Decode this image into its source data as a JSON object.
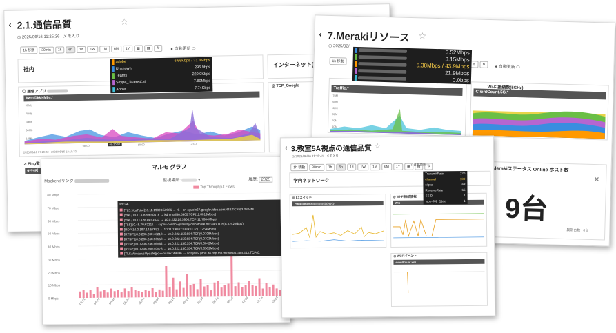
{
  "win1": {
    "title": "2.1.通信品質",
    "date": "2025/06/16 11:25:36",
    "fav": "メモ入り",
    "toolbar": [
      "1h 移動",
      "30min",
      "1h",
      "6h",
      "1d",
      "1W",
      "1M",
      "6M",
      "1Y"
    ],
    "auto": "自動更新",
    "section1": "社内",
    "section2": "インターネット(",
    "app_label": "通信アプリ",
    "tcp_label": "TCP_Google",
    "ping_label": "Ping監",
    "chart_header": "bwm@kkl4Mbs.*",
    "group_label": "group(",
    "time_label": "09:20:00",
    "x_ticks": [
      "08:00",
      "10:00",
      "12:00"
    ],
    "y_ticks": [
      "90Mb",
      "70Mb",
      "50Mb",
      "30Mb",
      "10Mb"
    ],
    "range": "2025/06/16 07:10:32 - 2025/06/16 13:10:32",
    "tooltip": [
      {
        "name": "adobe",
        "val": "6.66Kbps",
        "max": "31.8Mbps",
        "color": "#ff9900",
        "hl": true
      },
      {
        "name": "Unknown",
        "val": "295.9bps",
        "max": "",
        "color": "#3a8de0"
      },
      {
        "name": "Teams",
        "val": "229.9Kbps",
        "max": "",
        "color": "#6abf45"
      },
      {
        "name": "Skype_TeamsCall",
        "val": "7.80Mbps",
        "max": "",
        "color": "#b566d0"
      },
      {
        "name": "Apple",
        "val": "7.74Kbps",
        "max": "",
        "color": "#3fbfd8"
      }
    ]
  },
  "win2": {
    "title": "7.Merakiリソース",
    "date": "2025/02/",
    "toolbar": [
      "1h 移動"
    ],
    "auto": "自動更新",
    "traffic": "Traffic.*",
    "wifi": "Wi-Fi接続数(5GHz)",
    "client": "ClientCount.5G.*",
    "online_title": "Merakiステータス Online ホスト数",
    "big": "9台",
    "footer": "異常台数",
    "footer2": "0台",
    "tooltip": [
      {
        "val": "3.52Mbps",
        "max": "",
        "color": "#3a8de0"
      },
      {
        "val": "3.15Mbps",
        "max": "",
        "color": "#6abf45"
      },
      {
        "val": "5.38Mbps",
        "max": "43.9Mbps",
        "color": "#ff9900",
        "hl": true
      },
      {
        "val": "21.9Mbps",
        "max": "",
        "color": "#b566d0"
      },
      {
        "val": "0.0bps",
        "max": "",
        "color": "#3fbfd8"
      }
    ],
    "y_ticks": [
      "70M",
      "50M",
      "40M",
      "30M",
      "20M",
      "10M"
    ]
  },
  "win3": {
    "title": "3.教室5A視点の通信品質",
    "date": "2025/06/16 11:35:41",
    "fav": "メモ入り",
    "toolbar": [
      "1h 移動",
      "30min",
      "1h",
      "6h",
      "1d",
      "1W",
      "1M",
      "6M",
      "1Y"
    ],
    "auto": "自動更新",
    "section": "学内ネットワーク",
    "l3": "L3スイッチ",
    "wifi_info": "Wi-Fi接続情報",
    "wifi_event": "Wi-Fiイベント",
    "p1h": "Prtgg@mSwA@@@@@@@@",
    "p2h": "Wifi",
    "p3h": "eventCount.wifi",
    "tooltip": [
      {
        "name": "TransmitRate",
        "val": "120"
      },
      {
        "name": "channel",
        "val": "100",
        "hl": true
      },
      {
        "name": "signal",
        "val": "63"
      },
      {
        "name": "ReceiveRate",
        "val": "65"
      },
      {
        "name": "SSID",
        "val": "1"
      },
      {
        "name": "type-802_11ac",
        "val": "1"
      }
    ]
  },
  "win4": {
    "title": "マルモ グラフ",
    "link": "Mackerelリンク:",
    "monitor": "監視場所:",
    "hist": "履歴:",
    "hist_val": "2025",
    "legend": "Top Throughput Flows",
    "time": "09:34",
    "flows": [
      "[TLS:YouTube]10.11.19099:50986 → r5---sn-ogueln67.googlevideo.com:443:TCP(63.0304M",
      "[VNC]10.11.19099:50478 → kdn-mail30:5900:TCP(11.8619Mbps)",
      "[VNC]10.11.18614:51033 → 10.0.222.29:5900:TCP(11.7064Mbps)",
      "[TLS]10.48.70:63211 → sxpns-control-gateway.ciscothree.net:443:TCP(8.6242Mbps)",
      "[RDP]10.0.197.14:57851 → 10.11.19020:3389:TCP(0.1254Mbps)",
      "[RTSP]10.0.206.200:43218 → 10.0.222.150:554:TCP(0.0798Mbps)",
      "[RTSP]10.0.206.248:56558 → 10.0.222.150:554:TCP(0.0703Mbps)",
      "[RTSP]10.0.206.246:56562 → 10.0.222.150:554:TCP(0.0642Mbps)",
      "[RTSP]10.0.206.200:40578 → 10.0.222.150:554:TCP(0.0502Mbps)",
      "[TLS:WindowsUpdate]pc-e-nozaki:49696 → array802.prod.do.dsp.mp.microsoft.com:443:TCP(0."
    ],
    "y_ticks": [
      "80 Mbps",
      "70 Mbps",
      "60 Mbps",
      "50 Mbps",
      "40 Mbps",
      "30 Mbps",
      "20 Mbps",
      "10 Mbps",
      "0 Mbps"
    ],
    "x_ticks": [
      "08:14",
      "08:24",
      "08:34",
      "08:44",
      "08:54",
      "09:04",
      "09:14",
      "09:24",
      "09:34",
      "09:44",
      "09:54",
      "10:04",
      "10:14",
      "10:24"
    ],
    "chart_data": {
      "type": "bar",
      "ylim": [
        0,
        80
      ],
      "values": [
        5,
        6,
        4,
        6,
        3,
        8,
        5,
        6,
        4,
        7,
        5,
        6,
        4,
        7,
        5,
        8,
        6,
        5,
        4,
        6,
        5,
        7,
        4,
        6,
        5,
        24,
        8,
        15,
        6,
        12,
        7,
        18,
        9,
        10,
        6,
        14,
        8,
        9,
        5,
        11,
        12,
        7,
        9,
        10,
        73,
        8,
        11,
        7,
        9,
        12,
        9,
        8,
        14,
        6,
        10,
        7,
        9,
        6,
        5,
        8
      ]
    }
  }
}
